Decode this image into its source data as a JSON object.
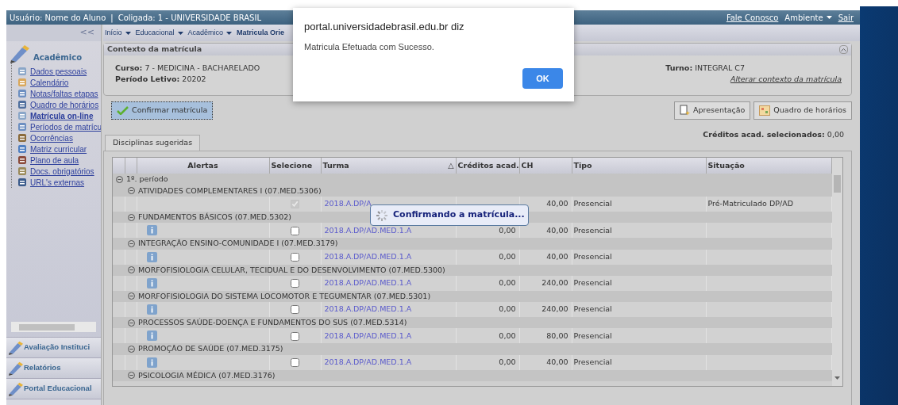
{
  "header": {
    "user": "Usuário: Nome do Aluno",
    "separator": "|",
    "coligada": "Coligada: 1 - UNIVERSIDADE BRASIL",
    "links": [
      {
        "label": "Fale Conosco",
        "kind": "link"
      },
      {
        "label": "Ambiente",
        "kind": "menu"
      },
      {
        "label": "Sair",
        "kind": "link"
      }
    ]
  },
  "sidebar": {
    "collapse": "<<",
    "title": "Acadêmico",
    "items": [
      {
        "label": "Dados pessoais",
        "selected": false
      },
      {
        "label": "Calendário",
        "selected": false
      },
      {
        "label": "Notas/faltas etapas",
        "selected": false
      },
      {
        "label": "Quadro de horários",
        "selected": false
      },
      {
        "label": "Matrícula on-line",
        "selected": true
      },
      {
        "label": "Períodos de matrícu",
        "selected": false
      },
      {
        "label": "Ocorrências",
        "selected": false
      },
      {
        "label": "Matriz curricular",
        "selected": false
      },
      {
        "label": "Plano de aula",
        "selected": false
      },
      {
        "label": "Docs. obrigatórios",
        "selected": false
      },
      {
        "label": "URL's externas",
        "selected": false
      }
    ],
    "sections": [
      {
        "label": "Avaliação Instituci"
      },
      {
        "label": "Relatórios"
      },
      {
        "label": "Portal Educacional"
      }
    ]
  },
  "breadcrumb": [
    {
      "label": "Início",
      "menu": true
    },
    {
      "label": "Educacional",
      "menu": true
    },
    {
      "label": "Acadêmico",
      "menu": true
    },
    {
      "label": "Matricula Orie",
      "menu": false
    }
  ],
  "context": {
    "title": "Contexto da matrícula",
    "fields": [
      {
        "label": "Curso:",
        "value": "7 - MEDICINA - BACHARELADO"
      },
      {
        "label": "Período Letivo:",
        "value": "20202"
      }
    ],
    "turno": {
      "label": "Turno:",
      "value": "INTEGRAL C7"
    },
    "change_link": "Alterar contexto da matrícula"
  },
  "confirm_button": "Confirmar matrícula",
  "action_buttons": [
    "Apresentação",
    "Quadro de horários"
  ],
  "credits": {
    "label": "Créditos acad. selecionados:",
    "value": "0,00"
  },
  "tabs": [
    {
      "label": "Disciplinas sugeridas",
      "selected": true
    }
  ],
  "table": {
    "columns": [
      "Alertas",
      "Selecione",
      "Turma",
      "Créditos acad.",
      "CH",
      "Tipo",
      "Situação"
    ],
    "sort_mark": "△",
    "period": "1º. período",
    "groups": [
      {
        "name": "ATIVIDADES COMPLEMENTARES I (07.MED.5306)",
        "row": {
          "alert": false,
          "checked": true,
          "disabled": true,
          "turma": "2018.A.DP/A",
          "ch": "40,00",
          "tipo": "Presencial",
          "situacao": "Pré-Matriculado DP/AD"
        }
      },
      {
        "name": "FUNDAMENTOS BÁSICOS (07.MED.5302)",
        "row": {
          "alert": true,
          "checked": false,
          "disabled": false,
          "turma": "2018.A.DP/AD.MED.1.A",
          "creditos": "0,00",
          "ch": "40,00",
          "tipo": "Presencial"
        }
      },
      {
        "name": "INTEGRAÇÃO ENSINO-COMUNIDADE I (07.MED.3179)",
        "row": {
          "alert": true,
          "checked": false,
          "disabled": false,
          "turma": "2018.A.DP/AD.MED.1.A",
          "creditos": "0,00",
          "ch": "40,00",
          "tipo": "Presencial"
        }
      },
      {
        "name": "MORFOFISIOLOGIA CELULAR, TECIDUAL E DO DESENVOLVIMENTO (07.MED.5300)",
        "row": {
          "alert": true,
          "checked": false,
          "disabled": false,
          "turma": "2018.A.DP/AD.MED.1.A",
          "creditos": "0,00",
          "ch": "240,00",
          "tipo": "Presencial"
        }
      },
      {
        "name": "MORFOFISIOLOGIA DO SISTEMA LOCOMOTOR E TEGUMENTAR (07.MED.5301)",
        "row": {
          "alert": true,
          "checked": false,
          "disabled": false,
          "turma": "2018.A.DP/AD.MED.1.A",
          "creditos": "0,00",
          "ch": "240,00",
          "tipo": "Presencial"
        }
      },
      {
        "name": "PROCESSOS SAÚDE-DOENÇA E FUNDAMENTOS DO SUS (07.MED.5314)",
        "row": {
          "alert": true,
          "checked": false,
          "disabled": false,
          "turma": "2018.A.DP/AD.MED.1.A",
          "creditos": "0,00",
          "ch": "80,00",
          "tipo": "Presencial"
        }
      },
      {
        "name": "PROMOÇÃO DE SAÚDE (07.MED.3175)",
        "row": {
          "alert": true,
          "checked": false,
          "disabled": false,
          "turma": "2018.A.DP/AD.MED.1.A",
          "creditos": "0,00",
          "ch": "40,00",
          "tipo": "Presencial"
        }
      },
      {
        "name": "PSICOLOGIA MÉDICA (07.MED.3176)"
      }
    ]
  },
  "loading": "Confirmando a matrícula...",
  "dialog": {
    "origin": "portal.universidadebrasil.edu.br diz",
    "message": "Matricula Efetuada com Sucesso.",
    "button": "OK"
  }
}
